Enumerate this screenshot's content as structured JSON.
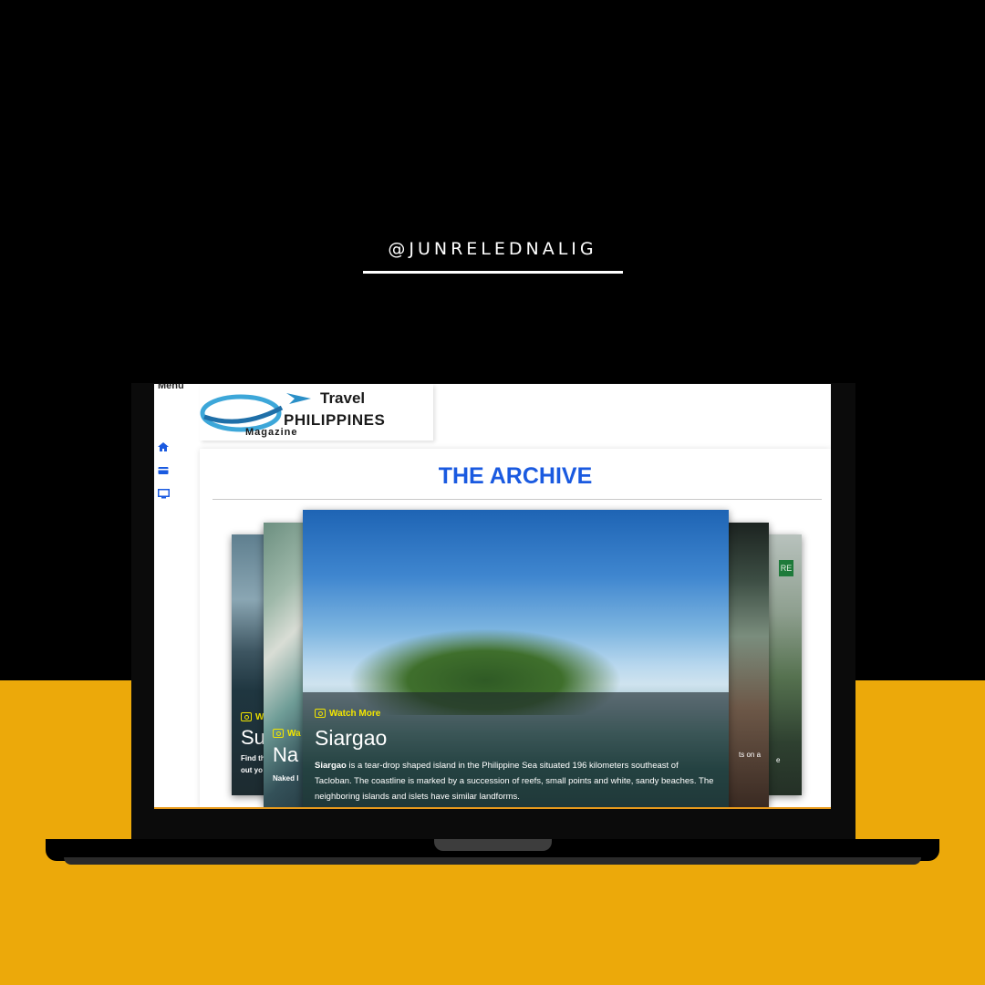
{
  "handle": "@JUNRELEDNALIG",
  "sidebar": {
    "menu_label": "Menu",
    "icons": [
      "home-icon",
      "card-icon",
      "monitor-icon"
    ]
  },
  "logo": {
    "line1": "Travel",
    "line2": "PHILIPPINES",
    "line3": "Magazine"
  },
  "archive": {
    "title": "THE ARCHIVE"
  },
  "carousel": {
    "watch_more": "Watch More",
    "main": {
      "title": "Siargao",
      "desc_bold": "Siargao",
      "desc_rest": " is a tear-drop shaped island in the Philippine Sea situated 196 kilometers southeast of Tacloban. The coastline is marked by a succession of reefs, small points and white, sandy beaches. The neighboring islands and islets have similar landforms."
    },
    "far_left": {
      "wm": "Wa",
      "title": "Su",
      "sub1": "Find th",
      "sub2": "out yo"
    },
    "left": {
      "wm": "Wa",
      "title": "Na",
      "sub1": "Naked I"
    },
    "right": {
      "snip": "ts on a"
    },
    "far_right": {
      "tag": "RE",
      "snip": "e"
    }
  },
  "colors": {
    "accent": "#1A5AE0",
    "watch_more": "#F3E600",
    "background_bottom": "#ECA90A"
  }
}
